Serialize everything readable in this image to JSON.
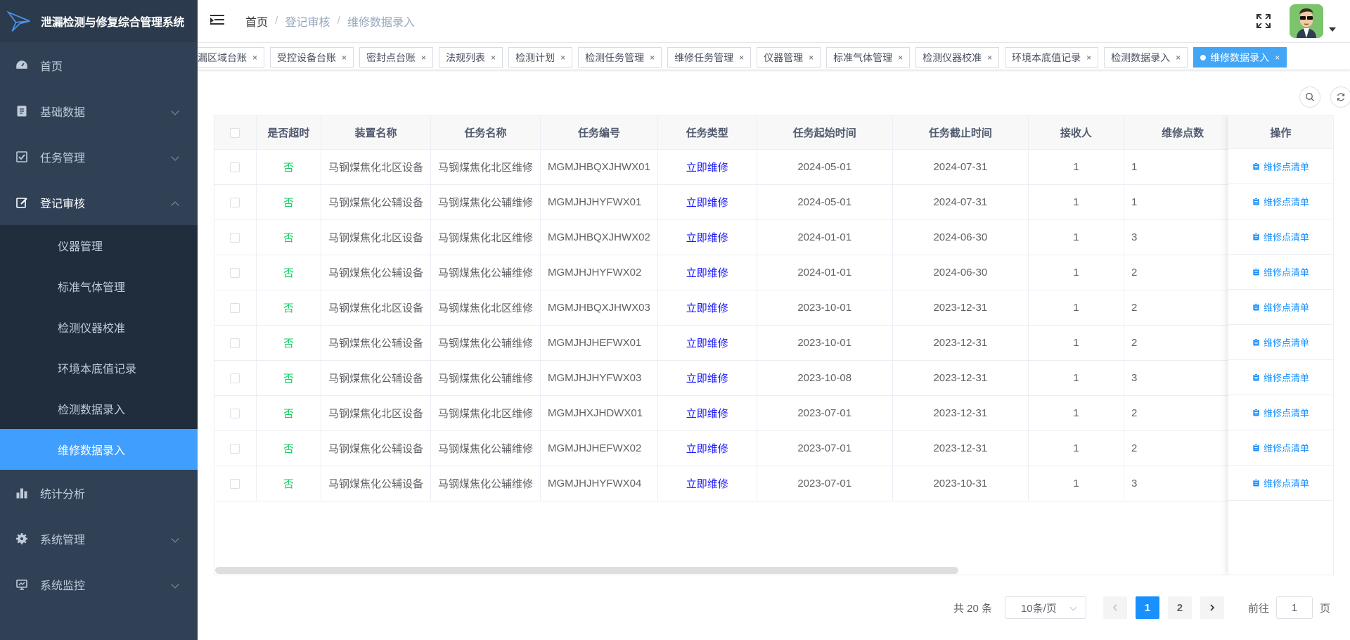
{
  "app": {
    "title": "泄漏检测与修复综合管理系统"
  },
  "sidebar": {
    "items": [
      {
        "label": "首页",
        "icon": "dashboard-icon"
      },
      {
        "label": "基础数据",
        "icon": "document-icon"
      },
      {
        "label": "任务管理",
        "icon": "checkbox-icon"
      },
      {
        "label": "登记审核",
        "icon": "edit-icon"
      },
      {
        "label": "统计分析",
        "icon": "bar-chart-icon"
      },
      {
        "label": "系统管理",
        "icon": "gear-icon"
      },
      {
        "label": "系统监控",
        "icon": "monitor-icon"
      }
    ],
    "submenu": [
      "仪器管理",
      "标准气体管理",
      "检测仪器校准",
      "环境本底值记录",
      "检测数据录入",
      "维修数据录入"
    ]
  },
  "breadcrumb": [
    "首页",
    "登记审核",
    "维修数据录入"
  ],
  "breadcrumb_sep": "/",
  "tags": [
    "泄漏区域台账",
    "受控设备台账",
    "密封点台账",
    "法规列表",
    "检测计划",
    "检测任务管理",
    "维修任务管理",
    "仪器管理",
    "标准气体管理",
    "检测仪器校准",
    "环境本底值记录",
    "检测数据录入",
    "维修数据录入"
  ],
  "tag_close": "×",
  "table": {
    "headers": [
      "是否超时",
      "装置名称",
      "任务名称",
      "任务编号",
      "任务类型",
      "任务起始时间",
      "任务截止时间",
      "接收人",
      "维修点数"
    ],
    "action_header": "操作",
    "action_label": "维修点清单",
    "rows": [
      [
        "否",
        "马钢煤焦化北区设备",
        "马钢煤焦化北区维修",
        "MGMJHBQXJHWX01",
        "立即维修",
        "2024-05-01",
        "2024-07-31",
        "1",
        "1"
      ],
      [
        "否",
        "马钢煤焦化公辅设备",
        "马钢煤焦化公辅维修",
        "MGMJHJHYFWX01",
        "立即维修",
        "2024-05-01",
        "2024-07-31",
        "1",
        "1"
      ],
      [
        "否",
        "马钢煤焦化北区设备",
        "马钢煤焦化北区维修",
        "MGMJHBQXJHWX02",
        "立即维修",
        "2024-01-01",
        "2024-06-30",
        "1",
        "3"
      ],
      [
        "否",
        "马钢煤焦化公辅设备",
        "马钢煤焦化公辅维修",
        "MGMJHJHYFWX02",
        "立即维修",
        "2024-01-01",
        "2024-06-30",
        "1",
        "2"
      ],
      [
        "否",
        "马钢煤焦化北区设备",
        "马钢煤焦化北区维修",
        "MGMJHBQXJHWX03",
        "立即维修",
        "2023-10-01",
        "2023-12-31",
        "1",
        "2"
      ],
      [
        "否",
        "马钢煤焦化公辅设备",
        "马钢煤焦化公辅维修",
        "MGMJHJHEFWX01",
        "立即维修",
        "2023-10-01",
        "2023-12-31",
        "1",
        "2"
      ],
      [
        "否",
        "马钢煤焦化公辅设备",
        "马钢煤焦化公辅维修",
        "MGMJHJHYFWX03",
        "立即维修",
        "2023-10-08",
        "2023-12-31",
        "1",
        "3"
      ],
      [
        "否",
        "马钢煤焦化北区设备",
        "马钢煤焦化北区维修",
        "MGMJHXJHDWX01",
        "立即维修",
        "2023-07-01",
        "2023-12-31",
        "1",
        "2"
      ],
      [
        "否",
        "马钢煤焦化公辅设备",
        "马钢煤焦化公辅维修",
        "MGMJHJHEFWX02",
        "立即维修",
        "2023-07-01",
        "2023-12-31",
        "1",
        "2"
      ],
      [
        "否",
        "马钢煤焦化公辅设备",
        "马钢煤焦化公辅维修",
        "MGMJHJHYFWX04",
        "立即维修",
        "2023-07-01",
        "2023-10-31",
        "1",
        "3"
      ]
    ]
  },
  "pagination": {
    "total": "共 20 条",
    "page_size": "10条/页",
    "pages": [
      "1",
      "2"
    ],
    "goto_prefix": "前往",
    "goto_value": "1",
    "goto_suffix": "页"
  },
  "colors": {
    "sidebar_bg": "#304156",
    "accent": "#409eff",
    "tag_active": "#42a5f5",
    "overtime_green": "#13ce66",
    "task_type_blue": "#1a1aff"
  }
}
